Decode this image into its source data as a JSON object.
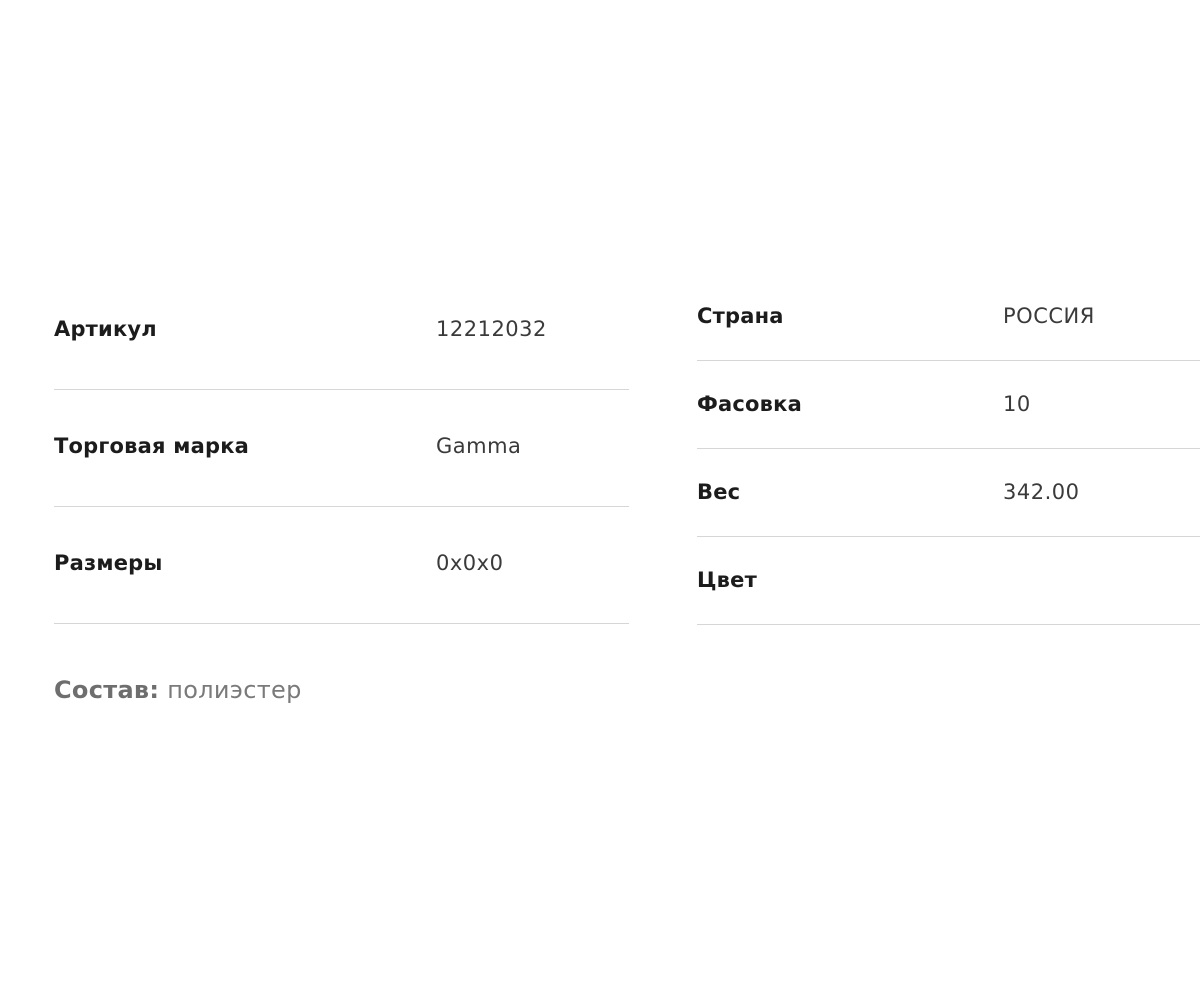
{
  "specs_left": [
    {
      "label": "Артикул",
      "value": "12212032"
    },
    {
      "label": "Торговая марка",
      "value": "Gamma"
    },
    {
      "label": "Размеры",
      "value": "0x0x0"
    }
  ],
  "specs_right": [
    {
      "label": "Страна",
      "value": "РОССИЯ"
    },
    {
      "label": "Фасовка",
      "value": "10"
    },
    {
      "label": "Вес",
      "value": "342.00"
    },
    {
      "label": "Цвет",
      "value": ""
    }
  ],
  "composition": {
    "label": "Состав:",
    "value": "полиэстер"
  },
  "colors": {
    "text_primary": "#1c1c1c",
    "text_secondary": "#3a3a3a",
    "text_muted": "#7a7a7a",
    "divider": "#d6d6d6",
    "background": "#ffffff"
  }
}
